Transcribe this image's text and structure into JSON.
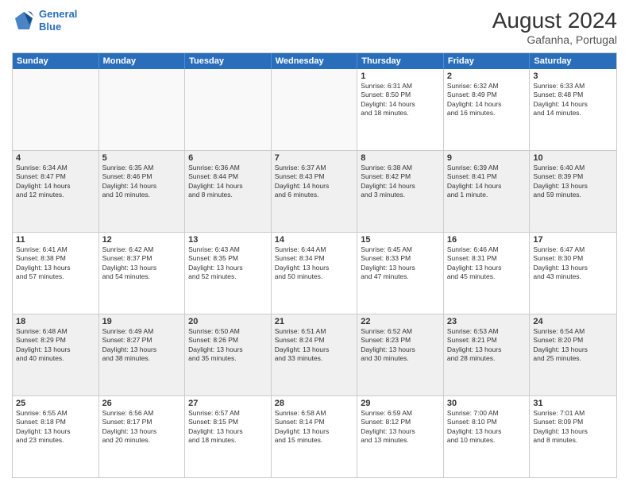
{
  "header": {
    "logo_line1": "General",
    "logo_line2": "Blue",
    "month": "August 2024",
    "location": "Gafanha, Portugal"
  },
  "days_of_week": [
    "Sunday",
    "Monday",
    "Tuesday",
    "Wednesday",
    "Thursday",
    "Friday",
    "Saturday"
  ],
  "weeks": [
    [
      {
        "day": "",
        "info": "",
        "empty": true
      },
      {
        "day": "",
        "info": "",
        "empty": true
      },
      {
        "day": "",
        "info": "",
        "empty": true
      },
      {
        "day": "",
        "info": "",
        "empty": true
      },
      {
        "day": "1",
        "info": "Sunrise: 6:31 AM\nSunset: 8:50 PM\nDaylight: 14 hours\nand 18 minutes."
      },
      {
        "day": "2",
        "info": "Sunrise: 6:32 AM\nSunset: 8:49 PM\nDaylight: 14 hours\nand 16 minutes."
      },
      {
        "day": "3",
        "info": "Sunrise: 6:33 AM\nSunset: 8:48 PM\nDaylight: 14 hours\nand 14 minutes."
      }
    ],
    [
      {
        "day": "4",
        "info": "Sunrise: 6:34 AM\nSunset: 8:47 PM\nDaylight: 14 hours\nand 12 minutes."
      },
      {
        "day": "5",
        "info": "Sunrise: 6:35 AM\nSunset: 8:46 PM\nDaylight: 14 hours\nand 10 minutes."
      },
      {
        "day": "6",
        "info": "Sunrise: 6:36 AM\nSunset: 8:44 PM\nDaylight: 14 hours\nand 8 minutes."
      },
      {
        "day": "7",
        "info": "Sunrise: 6:37 AM\nSunset: 8:43 PM\nDaylight: 14 hours\nand 6 minutes."
      },
      {
        "day": "8",
        "info": "Sunrise: 6:38 AM\nSunset: 8:42 PM\nDaylight: 14 hours\nand 3 minutes."
      },
      {
        "day": "9",
        "info": "Sunrise: 6:39 AM\nSunset: 8:41 PM\nDaylight: 14 hours\nand 1 minute."
      },
      {
        "day": "10",
        "info": "Sunrise: 6:40 AM\nSunset: 8:39 PM\nDaylight: 13 hours\nand 59 minutes."
      }
    ],
    [
      {
        "day": "11",
        "info": "Sunrise: 6:41 AM\nSunset: 8:38 PM\nDaylight: 13 hours\nand 57 minutes."
      },
      {
        "day": "12",
        "info": "Sunrise: 6:42 AM\nSunset: 8:37 PM\nDaylight: 13 hours\nand 54 minutes."
      },
      {
        "day": "13",
        "info": "Sunrise: 6:43 AM\nSunset: 8:35 PM\nDaylight: 13 hours\nand 52 minutes."
      },
      {
        "day": "14",
        "info": "Sunrise: 6:44 AM\nSunset: 8:34 PM\nDaylight: 13 hours\nand 50 minutes."
      },
      {
        "day": "15",
        "info": "Sunrise: 6:45 AM\nSunset: 8:33 PM\nDaylight: 13 hours\nand 47 minutes."
      },
      {
        "day": "16",
        "info": "Sunrise: 6:46 AM\nSunset: 8:31 PM\nDaylight: 13 hours\nand 45 minutes."
      },
      {
        "day": "17",
        "info": "Sunrise: 6:47 AM\nSunset: 8:30 PM\nDaylight: 13 hours\nand 43 minutes."
      }
    ],
    [
      {
        "day": "18",
        "info": "Sunrise: 6:48 AM\nSunset: 8:29 PM\nDaylight: 13 hours\nand 40 minutes."
      },
      {
        "day": "19",
        "info": "Sunrise: 6:49 AM\nSunset: 8:27 PM\nDaylight: 13 hours\nand 38 minutes."
      },
      {
        "day": "20",
        "info": "Sunrise: 6:50 AM\nSunset: 8:26 PM\nDaylight: 13 hours\nand 35 minutes."
      },
      {
        "day": "21",
        "info": "Sunrise: 6:51 AM\nSunset: 8:24 PM\nDaylight: 13 hours\nand 33 minutes."
      },
      {
        "day": "22",
        "info": "Sunrise: 6:52 AM\nSunset: 8:23 PM\nDaylight: 13 hours\nand 30 minutes."
      },
      {
        "day": "23",
        "info": "Sunrise: 6:53 AM\nSunset: 8:21 PM\nDaylight: 13 hours\nand 28 minutes."
      },
      {
        "day": "24",
        "info": "Sunrise: 6:54 AM\nSunset: 8:20 PM\nDaylight: 13 hours\nand 25 minutes."
      }
    ],
    [
      {
        "day": "25",
        "info": "Sunrise: 6:55 AM\nSunset: 8:18 PM\nDaylight: 13 hours\nand 23 minutes."
      },
      {
        "day": "26",
        "info": "Sunrise: 6:56 AM\nSunset: 8:17 PM\nDaylight: 13 hours\nand 20 minutes."
      },
      {
        "day": "27",
        "info": "Sunrise: 6:57 AM\nSunset: 8:15 PM\nDaylight: 13 hours\nand 18 minutes."
      },
      {
        "day": "28",
        "info": "Sunrise: 6:58 AM\nSunset: 8:14 PM\nDaylight: 13 hours\nand 15 minutes."
      },
      {
        "day": "29",
        "info": "Sunrise: 6:59 AM\nSunset: 8:12 PM\nDaylight: 13 hours\nand 13 minutes."
      },
      {
        "day": "30",
        "info": "Sunrise: 7:00 AM\nSunset: 8:10 PM\nDaylight: 13 hours\nand 10 minutes."
      },
      {
        "day": "31",
        "info": "Sunrise: 7:01 AM\nSunset: 8:09 PM\nDaylight: 13 hours\nand 8 minutes."
      }
    ]
  ]
}
